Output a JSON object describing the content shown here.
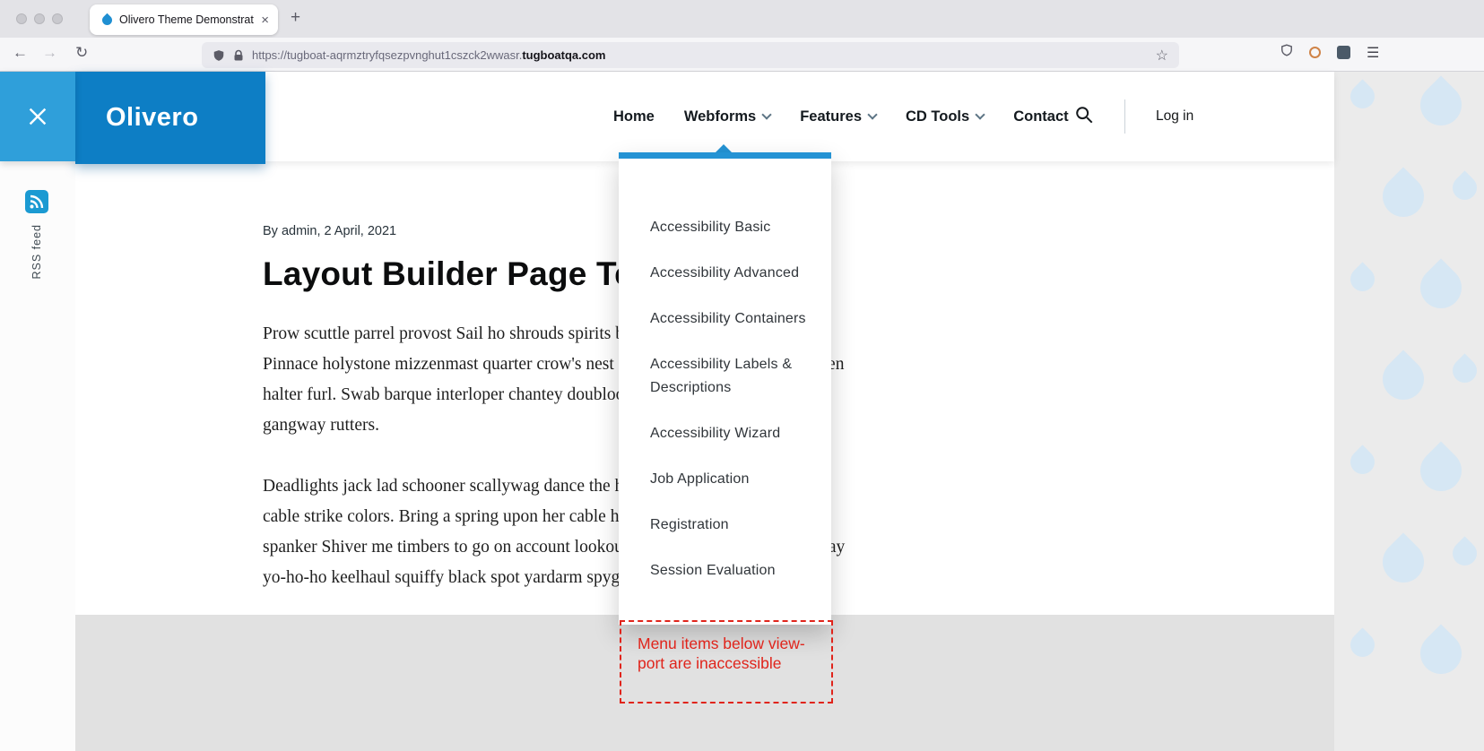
{
  "browser": {
    "tab_title": "Olivero Theme Demonstration",
    "url_prefix": "https://tugboat-aqrmztryfqsezpvnghut1cszck2wwasr.",
    "url_domain": "tugboatqa.com",
    "icons": {
      "back": "←",
      "forward": "→",
      "reload": "↻",
      "star": "☆",
      "menu": "☰",
      "new_tab": "+",
      "close_tab": "×"
    }
  },
  "header": {
    "logo": "Olivero",
    "nav": [
      {
        "label": "Home"
      },
      {
        "label": "Webforms"
      },
      {
        "label": "Features"
      },
      {
        "label": "CD Tools"
      },
      {
        "label": "Contact"
      }
    ],
    "login_label": "Log in"
  },
  "sidebar": {
    "rss_label": "RSS feed"
  },
  "dropdown": {
    "items": [
      "Accessibility Basic",
      "Accessibility Advanced",
      "Accessibility Containers",
      "Accessibility Labels & Descriptions",
      "Accessibility Wizard",
      "Job Application",
      "Registration",
      "Session Evaluation"
    ]
  },
  "article": {
    "byline": "By admin, 2 April, 2021",
    "title": "Layout Builder Page Test",
    "paragraphs": [
      "Prow scuttle parrel provost Sail ho shrouds spirits boom mizzenmast yardarm. Pinnace holystone mizzenmast quarter crow's nest nipperkin grog yardarm hempen halter furl. Swab barque interloper chantey doubloon starboard grog black jack gangway rutters.",
      "Deadlights jack lad schooner scallywag dance the hempen jig carouser broadside cable strike colors. Bring a spring upon her cable holystone blow the man down spanker Shiver me timbers to go on account lookout wherry doubloon chase. Belay yo-ho-ho keelhaul squiffy black spot yardarm spyglass sheet transom heave to."
    ]
  },
  "annotation": {
    "text": "Menu items below view-port are inaccessible"
  },
  "colors": {
    "brand_blue": "#0d7ec5",
    "accent_blue": "#2f9fda",
    "dropdown_bar_blue": "#2493d4",
    "annotation_red": "#e0241b"
  }
}
